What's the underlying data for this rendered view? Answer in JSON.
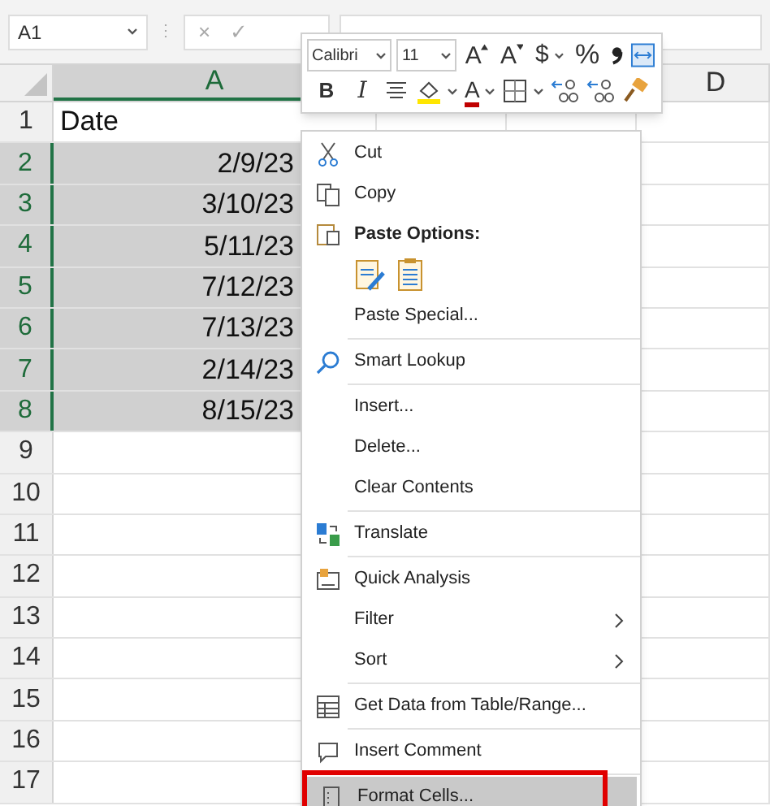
{
  "name_box": "A1",
  "grip": "⋮",
  "formula_buttons": [
    "×",
    "✓"
  ],
  "columns": [
    {
      "kind": "label",
      "label": "A",
      "selected": true
    },
    {
      "kind": "covered"
    },
    {
      "kind": "covered"
    },
    {
      "kind": "label",
      "label": "D",
      "selected": false
    }
  ],
  "rows": [
    {
      "number": "1",
      "kind": "text",
      "value": "Date",
      "selected": false
    },
    {
      "number": "2",
      "kind": "date",
      "value": "2/9/23",
      "selected": true
    },
    {
      "number": "3",
      "kind": "date",
      "value": "3/10/23",
      "selected": true
    },
    {
      "number": "4",
      "kind": "date",
      "value": "5/11/23",
      "selected": true
    },
    {
      "number": "5",
      "kind": "date",
      "value": "7/12/23",
      "selected": true
    },
    {
      "number": "6",
      "kind": "date",
      "value": "7/13/23",
      "selected": true
    },
    {
      "number": "7",
      "kind": "date",
      "value": "2/14/23",
      "selected": true
    },
    {
      "number": "8",
      "kind": "date",
      "value": "8/15/23",
      "selected": true
    },
    {
      "number": "9",
      "kind": "empty",
      "selected": false
    },
    {
      "number": "10",
      "kind": "empty",
      "selected": false
    },
    {
      "number": "11",
      "kind": "empty",
      "selected": false
    },
    {
      "number": "12",
      "kind": "empty",
      "selected": false
    },
    {
      "number": "13",
      "kind": "empty",
      "selected": false
    },
    {
      "number": "14",
      "kind": "empty",
      "selected": false
    },
    {
      "number": "15",
      "kind": "empty",
      "selected": false
    },
    {
      "number": "16",
      "kind": "empty",
      "selected": false
    },
    {
      "number": "17",
      "kind": "empty",
      "selected": false
    }
  ],
  "mini_toolbar": {
    "font": "Calibri",
    "size": "11",
    "row1": [
      {
        "kind": "grow",
        "label": "A"
      },
      {
        "kind": "shrink",
        "label": "A"
      },
      {
        "kind": "currency",
        "label": "$"
      },
      {
        "kind": "percent",
        "label": "%"
      },
      {
        "kind": "comma"
      },
      {
        "kind": "merge"
      }
    ],
    "row2": [
      {
        "kind": "bold",
        "label": "B"
      },
      {
        "kind": "italic",
        "label": "I"
      },
      {
        "kind": "align"
      },
      {
        "kind": "fill"
      },
      {
        "kind": "font_color",
        "label": "A"
      },
      {
        "kind": "borders"
      },
      {
        "kind": "inc_decimal"
      },
      {
        "kind": "dec_decimal"
      },
      {
        "kind": "painter"
      }
    ]
  },
  "context_menu": [
    {
      "kind": "cut",
      "label": "Cut",
      "selected": false
    },
    {
      "kind": "copy",
      "label": "Copy",
      "selected": false
    },
    {
      "kind": "paste_header",
      "label": "Paste Options:"
    },
    {
      "kind": "paste_icons"
    },
    {
      "kind": "plain",
      "label": "Paste Special...",
      "selected": false
    },
    {
      "kind": "separator"
    },
    {
      "kind": "lookup",
      "label": "Smart Lookup",
      "selected": false
    },
    {
      "kind": "separator"
    },
    {
      "kind": "plain",
      "label": "Insert...",
      "selected": false
    },
    {
      "kind": "plain",
      "label": "Delete...",
      "selected": false
    },
    {
      "kind": "plain",
      "label": "Clear Contents",
      "selected": false
    },
    {
      "kind": "separator"
    },
    {
      "kind": "translate",
      "label": "Translate",
      "selected": false
    },
    {
      "kind": "separator"
    },
    {
      "kind": "analysis",
      "label": "Quick Analysis",
      "selected": false
    },
    {
      "kind": "submenu",
      "label": "Filter",
      "selected": false
    },
    {
      "kind": "submenu",
      "label": "Sort",
      "selected": false
    },
    {
      "kind": "separator"
    },
    {
      "kind": "table",
      "label": "Get Data from Table/Range...",
      "selected": false
    },
    {
      "kind": "separator"
    },
    {
      "kind": "comment",
      "label": "Insert Comment",
      "selected": false
    },
    {
      "kind": "separator"
    },
    {
      "kind": "format",
      "label": "Format Cells...",
      "selected": true,
      "outlined": true
    }
  ]
}
